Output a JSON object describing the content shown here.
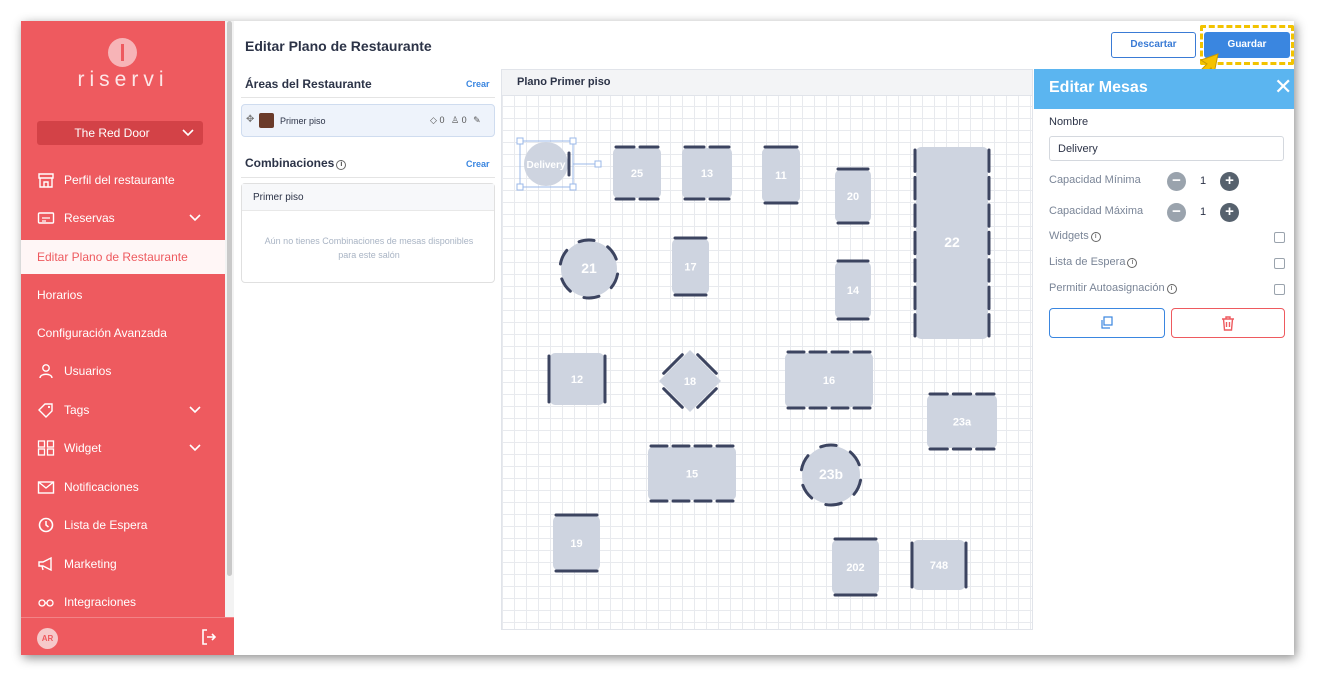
{
  "sidebar": {
    "logo_text": "riservi",
    "restaurant_select": "The Red Door",
    "items": [
      {
        "label": "Perfil del restaurante",
        "icon": "storefront-icon"
      },
      {
        "label": "Reservas",
        "icon": "calendar-ticket-icon"
      },
      {
        "label": "Editar Plano de Restaurante",
        "icon": ""
      },
      {
        "label": "Horarios",
        "icon": ""
      },
      {
        "label": "Configuración Avanzada",
        "icon": ""
      },
      {
        "label": "Usuarios",
        "icon": "user-icon"
      },
      {
        "label": "Tags",
        "icon": "tag-icon"
      },
      {
        "label": "Widget",
        "icon": "widget-grid-icon"
      },
      {
        "label": "Notificaciones",
        "icon": "envelope-icon"
      },
      {
        "label": "Lista de Espera",
        "icon": "clock-icon"
      },
      {
        "label": "Marketing",
        "icon": "megaphone-icon"
      },
      {
        "label": "Integraciones",
        "icon": "integrations-icon"
      }
    ],
    "user_initials": "AR"
  },
  "header": {
    "title": "Editar Plano de Restaurante",
    "discard_label": "Descartar",
    "save_label": "Guardar"
  },
  "areas": {
    "title": "Áreas del Restaurante",
    "create_label": "Crear",
    "items": [
      {
        "name": "Primer piso",
        "tables": "0",
        "people": "0"
      }
    ]
  },
  "combinations": {
    "title": "Combinaciones",
    "create_label": "Crear",
    "group": "Primer piso",
    "empty_text": "Aún no tienes Combinaciones de mesas disponibles para este salón"
  },
  "plan": {
    "title": "Plano Primer piso",
    "tables": [
      "Delivery",
      "25",
      "13",
      "11",
      "20",
      "22",
      "21",
      "17",
      "14",
      "12",
      "18",
      "16",
      "23a",
      "15",
      "23b",
      "19",
      "202",
      "748"
    ]
  },
  "editor": {
    "title": "Editar Mesas",
    "name_label": "Nombre",
    "name_value": "Delivery",
    "min_capacity_label": "Capacidad Mínima",
    "min_capacity": "1",
    "max_capacity_label": "Capacidad Máxima",
    "max_capacity": "1",
    "widgets_label": "Widgets",
    "waitlist_label": "Lista de Espera",
    "auto_assign_label": "Permitir Autoasignación",
    "colors": {
      "accent": "#3a86e0",
      "danger": "#ee5a5f",
      "header": "#5bb5f0"
    }
  }
}
